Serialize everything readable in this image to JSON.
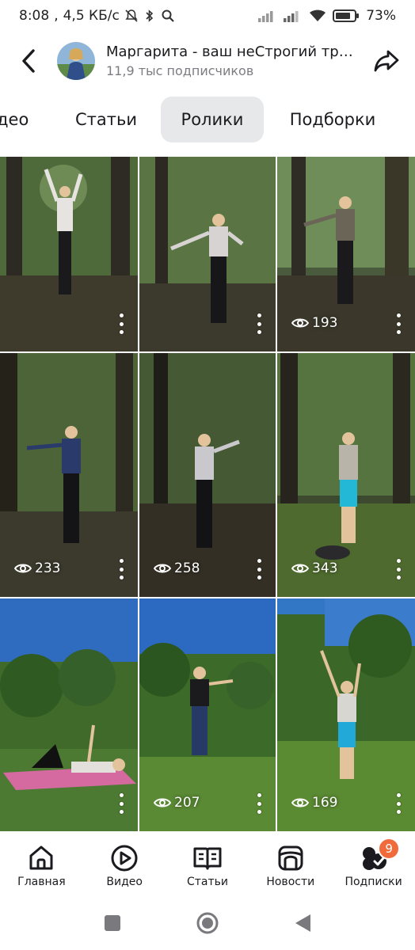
{
  "status_bar": {
    "time": "8:08",
    "speed": "4,5 КБ/с",
    "battery": "73"
  },
  "header": {
    "channel_title": "Маргарита - ваш неСтрогий тре...",
    "subscribers": "11,9 тыс подписчиков"
  },
  "tabs": [
    {
      "label": "део",
      "active": false
    },
    {
      "label": "Статьи",
      "active": false
    },
    {
      "label": "Ролики",
      "active": true
    },
    {
      "label": "Подборки",
      "active": false
    }
  ],
  "videos": [
    {
      "views": ""
    },
    {
      "views": ""
    },
    {
      "views": "193"
    },
    {
      "views": "233"
    },
    {
      "views": "258"
    },
    {
      "views": "343"
    },
    {
      "views": ""
    },
    {
      "views": "207"
    },
    {
      "views": "169"
    }
  ],
  "bottom_nav": {
    "items": [
      {
        "label": "Главная",
        "icon": "home-icon"
      },
      {
        "label": "Видео",
        "icon": "play-icon"
      },
      {
        "label": "Статьи",
        "icon": "book-icon"
      },
      {
        "label": "Новости",
        "icon": "news-icon"
      },
      {
        "label": "Подписки",
        "icon": "subscriptions-icon"
      }
    ],
    "subscriptions_badge": "9"
  },
  "colors": {
    "badge": "#f06a3c",
    "active_tab_bg": "#e7e8ea"
  }
}
